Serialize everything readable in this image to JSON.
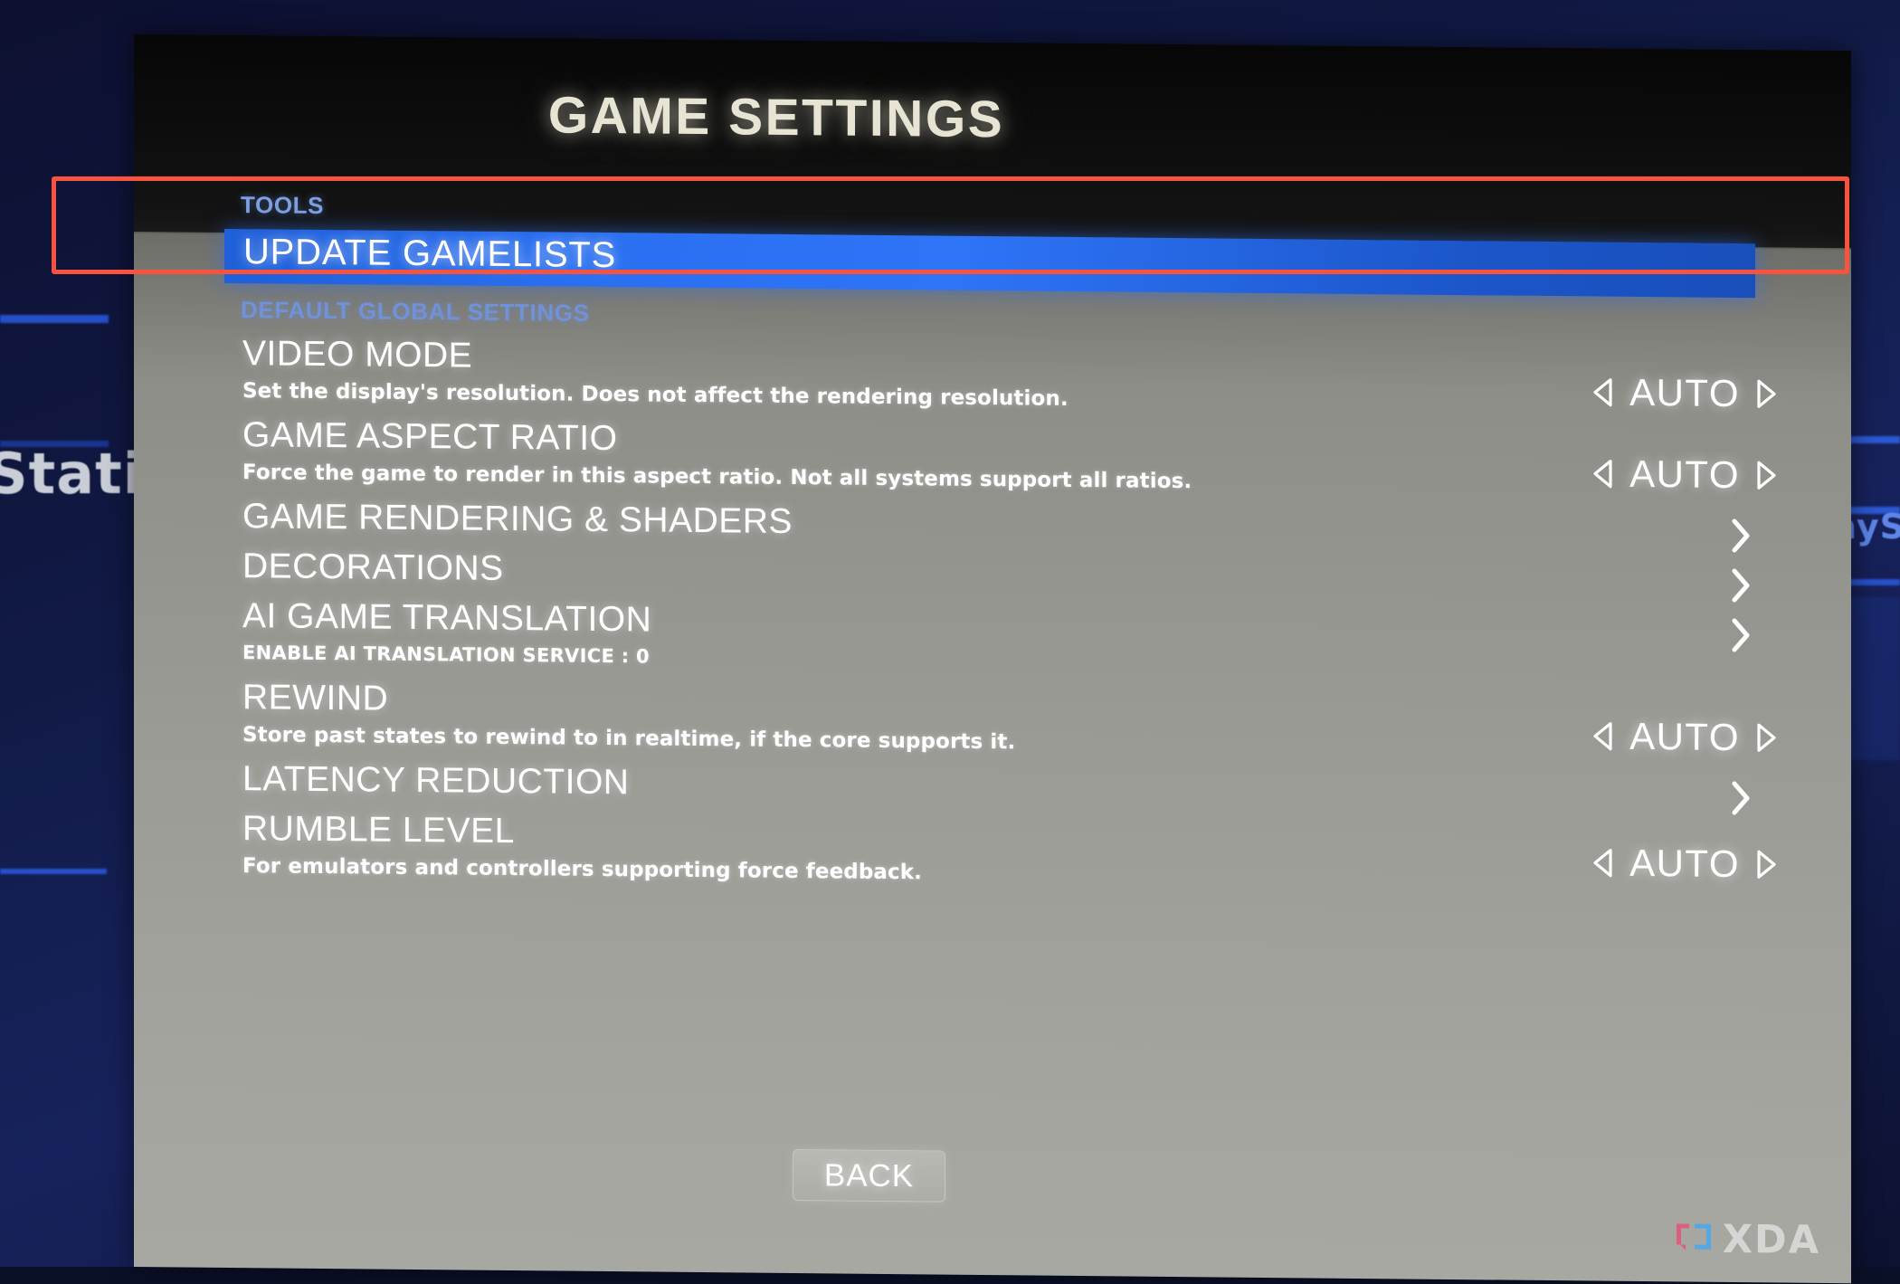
{
  "background": {
    "text_left": "Stati",
    "text_right": "layS"
  },
  "header": {
    "title": "GAME SETTINGS"
  },
  "sections": {
    "tools": "TOOLS",
    "default_global": "DEFAULT GLOBAL SETTINGS"
  },
  "selected_row": {
    "label": "UPDATE GAMELISTS"
  },
  "rows": [
    {
      "title": "VIDEO MODE",
      "description": "Set the display's resolution. Does not affect the rendering resolution.",
      "control": "stepper",
      "value": "AUTO"
    },
    {
      "title": "GAME ASPECT RATIO",
      "description": "Force the game to render in this aspect ratio. Not all systems support all ratios.",
      "control": "stepper",
      "value": "AUTO"
    },
    {
      "title": "GAME RENDERING & SHADERS",
      "description": "",
      "control": "submenu",
      "value": ">"
    },
    {
      "title": "DECORATIONS",
      "description": "",
      "control": "submenu",
      "value": ">"
    },
    {
      "title": "AI GAME TRANSLATION",
      "description": "ENABLE AI TRANSLATION SERVICE : 0",
      "control": "submenu",
      "value": ">"
    },
    {
      "title": "REWIND",
      "description": "Store past states to rewind to in realtime, if the core supports it.",
      "control": "stepper",
      "value": "AUTO"
    },
    {
      "title": "LATENCY REDUCTION",
      "description": "",
      "control": "submenu",
      "value": ">"
    },
    {
      "title": "RUMBLE LEVEL",
      "description": "For emulators and controllers supporting force feedback.",
      "control": "stepper",
      "value": "AUTO"
    }
  ],
  "footer": {
    "back_label": "BACK"
  },
  "watermark": {
    "text": "XDA"
  },
  "colors": {
    "selected_row_blue": "#2a6ff0",
    "annotation_red": "#f8533f",
    "section_header_blue": "#7e9fe0",
    "title_cream": "#e8e4d4",
    "panel_gray": "#9a9a95"
  }
}
